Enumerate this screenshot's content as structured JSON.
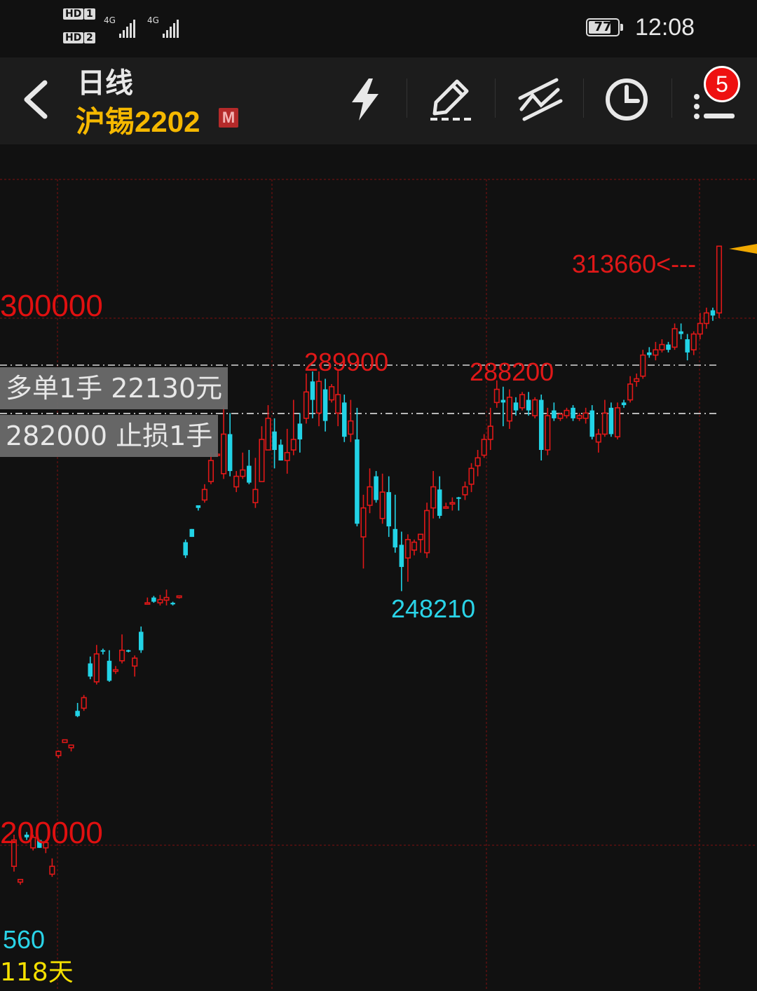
{
  "status_bar": {
    "sim1": "HD",
    "sim1_num": "1",
    "sim2": "HD",
    "sim2_num": "2",
    "network1": "4G",
    "network2": "4G",
    "battery": "77",
    "battery_level": 0.77,
    "time": "12:08"
  },
  "header": {
    "period": "日线",
    "instrument": "沪锡2202",
    "badge": "M",
    "notification_count": "5",
    "tools": [
      "lightning-icon",
      "pencil-icon",
      "trend-lines-icon",
      "clock-icon",
      "list-icon"
    ]
  },
  "orders": {
    "long_label": "多单1手  22130元",
    "stop_label": "282000 止损1手"
  },
  "annotations": {
    "high_mark": "313660<---",
    "peak_left": "289900",
    "peak_mid": "288200",
    "low_mark": "248210"
  },
  "axis": {
    "upper_label": "300000",
    "lower_label": "200000"
  },
  "footer": {
    "value": "560",
    "days": "118天"
  },
  "colors": {
    "up": "#e01818",
    "down": "#22d3e6",
    "grid": "#5a1010",
    "background": "#111111"
  },
  "chart_data": {
    "type": "candlestick",
    "y_axis_labels": [
      "300000",
      "200000"
    ],
    "levels": [
      {
        "label": "多单1手  22130元",
        "price": 291000
      },
      {
        "label": "282000 止损1手",
        "price": 282000
      }
    ],
    "annotations": [
      {
        "label": "313660",
        "price": 313660
      },
      {
        "label": "289900",
        "price": 289900
      },
      {
        "label": "288200",
        "price": 288200
      },
      {
        "label": "248210",
        "price": 248210
      }
    ],
    "candles": [
      [
        196000,
        201000,
        195000,
        202000
      ],
      [
        193000,
        193500,
        192500,
        193500
      ],
      [
        202000,
        201500,
        201000,
        202500
      ],
      [
        199500,
        201500,
        199000,
        202000
      ],
      [
        201000,
        199500,
        199500,
        201000
      ],
      [
        199500,
        200500,
        198500,
        201000
      ],
      [
        194500,
        196000,
        194000,
        197500
      ],
      [
        217000,
        217800,
        216500,
        218000
      ],
      [
        219500,
        220000,
        219500,
        220000
      ],
      [
        218500,
        219000,
        217800,
        219000
      ],
      [
        225500,
        224500,
        224300,
        227000
      ],
      [
        226000,
        228000,
        225500,
        228500
      ],
      [
        234500,
        232000,
        231500,
        235800
      ],
      [
        231000,
        236300,
        230500,
        238000
      ],
      [
        237000,
        236800,
        236200,
        237300
      ],
      [
        235000,
        231200,
        231000,
        237000
      ],
      [
        233000,
        233300,
        232500,
        234000
      ],
      [
        235000,
        237000,
        234500,
        240000
      ],
      [
        237000,
        236800,
        236600,
        237100
      ],
      [
        234000,
        235500,
        232000,
        236000
      ],
      [
        240500,
        237000,
        236500,
        241500
      ],
      [
        246000,
        246000,
        246000,
        247000
      ],
      [
        247000,
        246200,
        246000,
        247300
      ],
      [
        246000,
        246600,
        245500,
        247500
      ],
      [
        246500,
        247000,
        245500,
        248500
      ],
      [
        246000,
        245700,
        245500,
        246200
      ],
      [
        247000,
        247300,
        246800,
        247400
      ],
      [
        257500,
        255000,
        254500,
        258000
      ],
      [
        260000,
        258500,
        258500,
        260000
      ],
      [
        264500,
        264000,
        263500,
        264500
      ],
      [
        265500,
        267500,
        265000,
        268500
      ],
      [
        269000,
        273000,
        268500,
        274500
      ],
      [
        274000,
        274200,
        273800,
        274500
      ],
      [
        270500,
        278000,
        269500,
        283500
      ],
      [
        278000,
        271000,
        270000,
        282000
      ],
      [
        268000,
        270000,
        267000,
        271000
      ],
      [
        270000,
        271200,
        269500,
        274500
      ],
      [
        272000,
        268800,
        268500,
        275000
      ],
      [
        265000,
        267500,
        264000,
        273500
      ],
      [
        269000,
        277000,
        269000,
        279500
      ],
      [
        275000,
        281000,
        275000,
        283500
      ],
      [
        278500,
        275000,
        271500,
        281000
      ],
      [
        276000,
        273000,
        273000,
        277000
      ],
      [
        273000,
        274500,
        270500,
        279000
      ],
      [
        275000,
        277000,
        274000,
        284500
      ],
      [
        280000,
        277000,
        274500,
        282000
      ],
      [
        281000,
        286000,
        280000,
        289500
      ],
      [
        288000,
        284500,
        281000,
        289900
      ],
      [
        282000,
        288000,
        279500,
        289900
      ],
      [
        286500,
        280500,
        278500,
        288500
      ],
      [
        284500,
        287000,
        284000,
        287500
      ],
      [
        282000,
        285500,
        279500,
        290000
      ],
      [
        284000,
        277500,
        276500,
        285500
      ],
      [
        278000,
        280500,
        276500,
        284500
      ],
      [
        277000,
        261000,
        260500,
        283000
      ],
      [
        258500,
        264000,
        252500,
        266500
      ],
      [
        264500,
        268000,
        263000,
        271500
      ],
      [
        270000,
        265500,
        265000,
        271000
      ],
      [
        262000,
        267000,
        261000,
        270500
      ],
      [
        267000,
        260500,
        258500,
        270000
      ],
      [
        260000,
        256500,
        255500,
        266500
      ],
      [
        257000,
        252800,
        248210,
        259500
      ],
      [
        254500,
        258000,
        250000,
        259000
      ],
      [
        256000,
        257500,
        255000,
        258000
      ],
      [
        258000,
        259000,
        255500,
        258500
      ],
      [
        255500,
        263500,
        254500,
        265000
      ],
      [
        264000,
        268000,
        262000,
        271000
      ],
      [
        267500,
        262500,
        262000,
        270000
      ],
      [
        264000,
        264200,
        263800,
        265000
      ],
      [
        264800,
        265000,
        263500,
        266000
      ],
      [
        266000,
        265900,
        263500,
        266100
      ],
      [
        266500,
        268000,
        265500,
        269000
      ],
      [
        268500,
        271500,
        267000,
        272500
      ],
      [
        272000,
        273500,
        270000,
        275000
      ],
      [
        274000,
        277000,
        273500,
        278000
      ],
      [
        277000,
        279500,
        275000,
        283000
      ],
      [
        284000,
        286500,
        283000,
        288200
      ],
      [
        284500,
        284000,
        279500,
        287000
      ],
      [
        280500,
        285000,
        279000,
        286500
      ],
      [
        284000,
        282500,
        281500,
        285000
      ],
      [
        283000,
        285500,
        282500,
        286000
      ],
      [
        284500,
        282500,
        281500,
        286000
      ],
      [
        281500,
        284500,
        281000,
        285000
      ],
      [
        284500,
        275000,
        273000,
        285500
      ],
      [
        275000,
        281500,
        274000,
        283000
      ],
      [
        282500,
        281000,
        280500,
        284000
      ],
      [
        281000,
        281800,
        280500,
        282000
      ],
      [
        281500,
        282500,
        281000,
        283000
      ],
      [
        283000,
        281000,
        280500,
        283500
      ],
      [
        281000,
        281500,
        280500,
        282000
      ],
      [
        281000,
        282000,
        280000,
        283000
      ],
      [
        282500,
        277500,
        277000,
        283500
      ],
      [
        276500,
        278000,
        274500,
        279000
      ],
      [
        278000,
        282000,
        277500,
        284500
      ],
      [
        283000,
        278000,
        277500,
        284000
      ],
      [
        277500,
        283000,
        277000,
        284000
      ],
      [
        284000,
        283500,
        283000,
        284500
      ],
      [
        284500,
        287500,
        284000,
        289000
      ],
      [
        288000,
        288500,
        287000,
        289500
      ],
      [
        289000,
        293000,
        288500,
        294000
      ],
      [
        293500,
        293000,
        292500,
        294500
      ],
      [
        293000,
        294000,
        292000,
        295500
      ],
      [
        294000,
        295000,
        293500,
        296000
      ],
      [
        295000,
        294000,
        293500,
        295500
      ],
      [
        294500,
        298000,
        294000,
        299000
      ],
      [
        297500,
        297000,
        296000,
        299000
      ],
      [
        296000,
        293500,
        292000,
        297000
      ],
      [
        294000,
        297000,
        293000,
        297500
      ],
      [
        297000,
        299000,
        296000,
        301000
      ],
      [
        299000,
        301000,
        298000,
        302000
      ],
      [
        301500,
        300500,
        299500,
        302000
      ],
      [
        301000,
        313660,
        300000,
        313660
      ]
    ]
  }
}
